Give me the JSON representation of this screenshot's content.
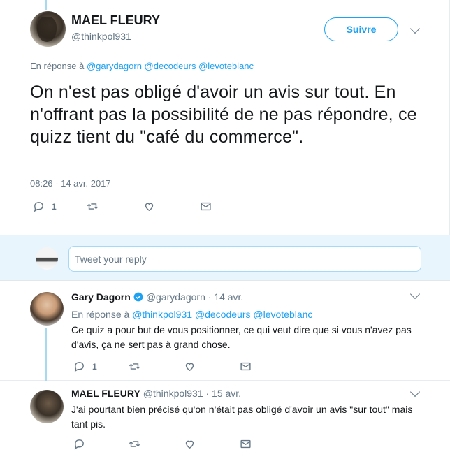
{
  "main_tweet": {
    "name": "MAEL FLEURY",
    "handle": "@thinkpol931",
    "follow_label": "Suivre",
    "reply_prefix": "En réponse à",
    "reply_mentions": "@garydagorn @decodeurs @levoteblanc",
    "text": "On n'est pas obligé d'avoir un avis sur tout. En n'offrant pas la possibilité de ne pas répondre, ce quizz tient du \"café du commerce\".",
    "timestamp": "08:26 - 14 avr. 2017",
    "reply_count": "1"
  },
  "reply_box": {
    "placeholder": "Tweet your reply"
  },
  "replies": [
    {
      "name": "Gary Dagorn",
      "verified": true,
      "meta": "@garydagorn · 14 avr.",
      "reply_prefix": "En réponse à",
      "reply_mentions": "@thinkpol931 @decodeurs @levoteblanc",
      "text": "Ce quiz a pour but de vous positionner, ce qui veut dire que si vous n'avez pas d'avis, ça ne sert pas à grand chose.",
      "reply_count": "1"
    },
    {
      "name": "MAEL FLEURY",
      "meta": "@thinkpol931 · 15 avr.",
      "text": "J'ai pourtant bien précisé qu'on n'était pas obligé d'avoir un avis \"sur tout\" mais tant pis."
    }
  ],
  "colors": {
    "accent": "#1da1f2",
    "muted": "#657786",
    "reply_bar_bg": "#e8f5fd",
    "thread_line": "#a7d9ef"
  },
  "icons": [
    "reply-icon",
    "retweet-icon",
    "heart-icon",
    "message-icon",
    "chevron-down-icon",
    "verified-icon"
  ]
}
